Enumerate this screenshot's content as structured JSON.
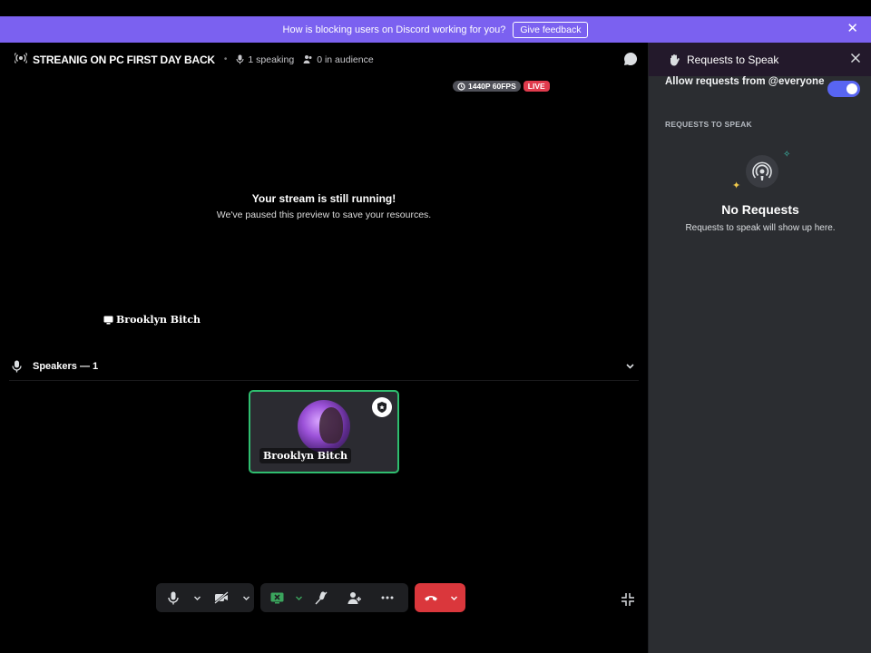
{
  "banner": {
    "text": "How is blocking users on Discord working for you?",
    "button": "Give feedback"
  },
  "header": {
    "title": "STREANIG ON PC FIRST DAY BACK",
    "separator": "•",
    "speaking": "1 speaking",
    "audience": "0 in audience"
  },
  "stream": {
    "quality": "1440P 60FPS",
    "live": "LIVE",
    "paused_title": "Your stream is still running!",
    "paused_sub": "We've paused this preview to save your resources.",
    "streamer": "Brooklyn Bitch"
  },
  "speakers": {
    "label": "Speakers — 1",
    "tile_name": "Brooklyn Bitch"
  },
  "panel": {
    "title": "Requests to Speak",
    "allow_label": "Allow requests from @everyone",
    "allow_enabled": true,
    "section": "REQUESTS TO SPEAK",
    "empty_title": "No Requests",
    "empty_sub": "Requests to speak will show up here."
  },
  "colors": {
    "banner": "#7b61f0",
    "live": "#e03b4d",
    "speaking_border": "#2fbe6f",
    "toggle": "#5865f2",
    "hangup": "#da373c"
  }
}
